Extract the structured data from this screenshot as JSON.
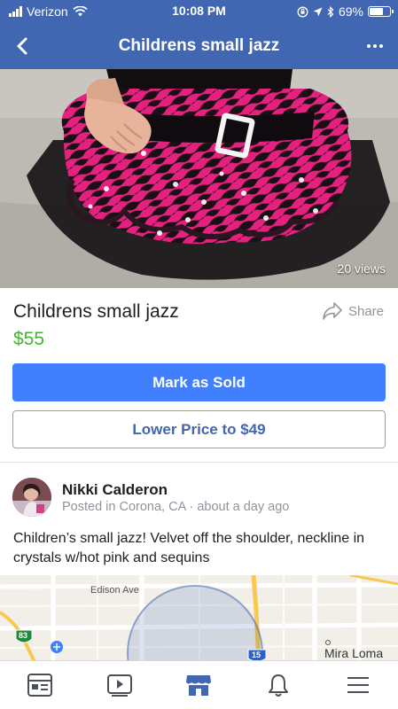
{
  "status_bar": {
    "carrier": "Verizon",
    "time": "10:08 PM",
    "battery_percent": "69%",
    "battery_level": 0.69
  },
  "navbar": {
    "title": "Childrens small jazz",
    "back_icon": "chevron-left-icon",
    "more_icon": "more-horizontal-icon"
  },
  "photo": {
    "views": "20 views"
  },
  "listing": {
    "title": "Childrens small jazz",
    "price": "$55",
    "share_label": "Share"
  },
  "actions": {
    "mark_sold_label": "Mark as Sold",
    "lower_price_label": "Lower Price to $49"
  },
  "seller": {
    "name": "Nikki Calderon",
    "meta": "Posted in Corona, CA · about a day ago"
  },
  "description": "Children’s small jazz! Velvet off the shoulder, neckline in crystals w/hot pink and sequins",
  "map": {
    "street_label": "Edison Ave",
    "city_label": "Mira Loma",
    "route_83": "83",
    "route_15": "15"
  },
  "tabbar": {
    "items": [
      {
        "name": "news-feed",
        "icon": "newsfeed-icon",
        "active": false
      },
      {
        "name": "watch",
        "icon": "video-play-icon",
        "active": false
      },
      {
        "name": "marketplace",
        "icon": "marketplace-icon",
        "active": true
      },
      {
        "name": "notifications",
        "icon": "bell-icon",
        "active": false
      },
      {
        "name": "menu",
        "icon": "hamburger-menu-icon",
        "active": false
      }
    ]
  },
  "colors": {
    "header": "#4267b2",
    "price": "#42b72a",
    "primary_button": "#4080ff",
    "secondary_text": "#90949c"
  }
}
